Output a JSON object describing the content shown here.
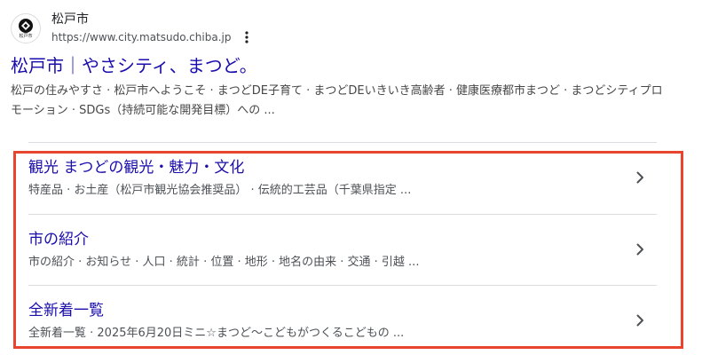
{
  "site": {
    "favicon_label": "松戸市",
    "name": "松戸市",
    "url": "https://www.city.matsudo.chiba.jp"
  },
  "result": {
    "title": "松戸市｜やさシティ、まつど。",
    "snippet": "松戸の住みやすさ · 松戸市へようこそ · まつどDE子育て · まつどDEいきいき高齢者 · 健康医療都市まつど · まつどシティプロモーション · SDGs（持続可能な開発目標）への ..."
  },
  "sitelinks": [
    {
      "title": "観光 まつどの観光・魅力・文化",
      "description": "特産品 · お土産（松戸市観光協会推奨品） · 伝統的工芸品（千葉県指定 ..."
    },
    {
      "title": "市の紹介",
      "description": "市の紹介 · お知らせ · 人口 · 統計 · 位置 · 地形 · 地名の由来 · 交通 · 引越 ..."
    },
    {
      "title": "全新着一覧",
      "description": "全新着一覧 · 2025年6月20日ミニ☆まつど〜こどもがつくるこどもの ..."
    }
  ],
  "colors": {
    "link": "#1a0dab",
    "highlight_border": "#e8452f",
    "text_secondary": "#4d5156"
  },
  "icons": {
    "favicon": "matsudo-city-emblem-icon",
    "more": "more-vertical-icon",
    "chevron": "chevron-right-icon"
  }
}
